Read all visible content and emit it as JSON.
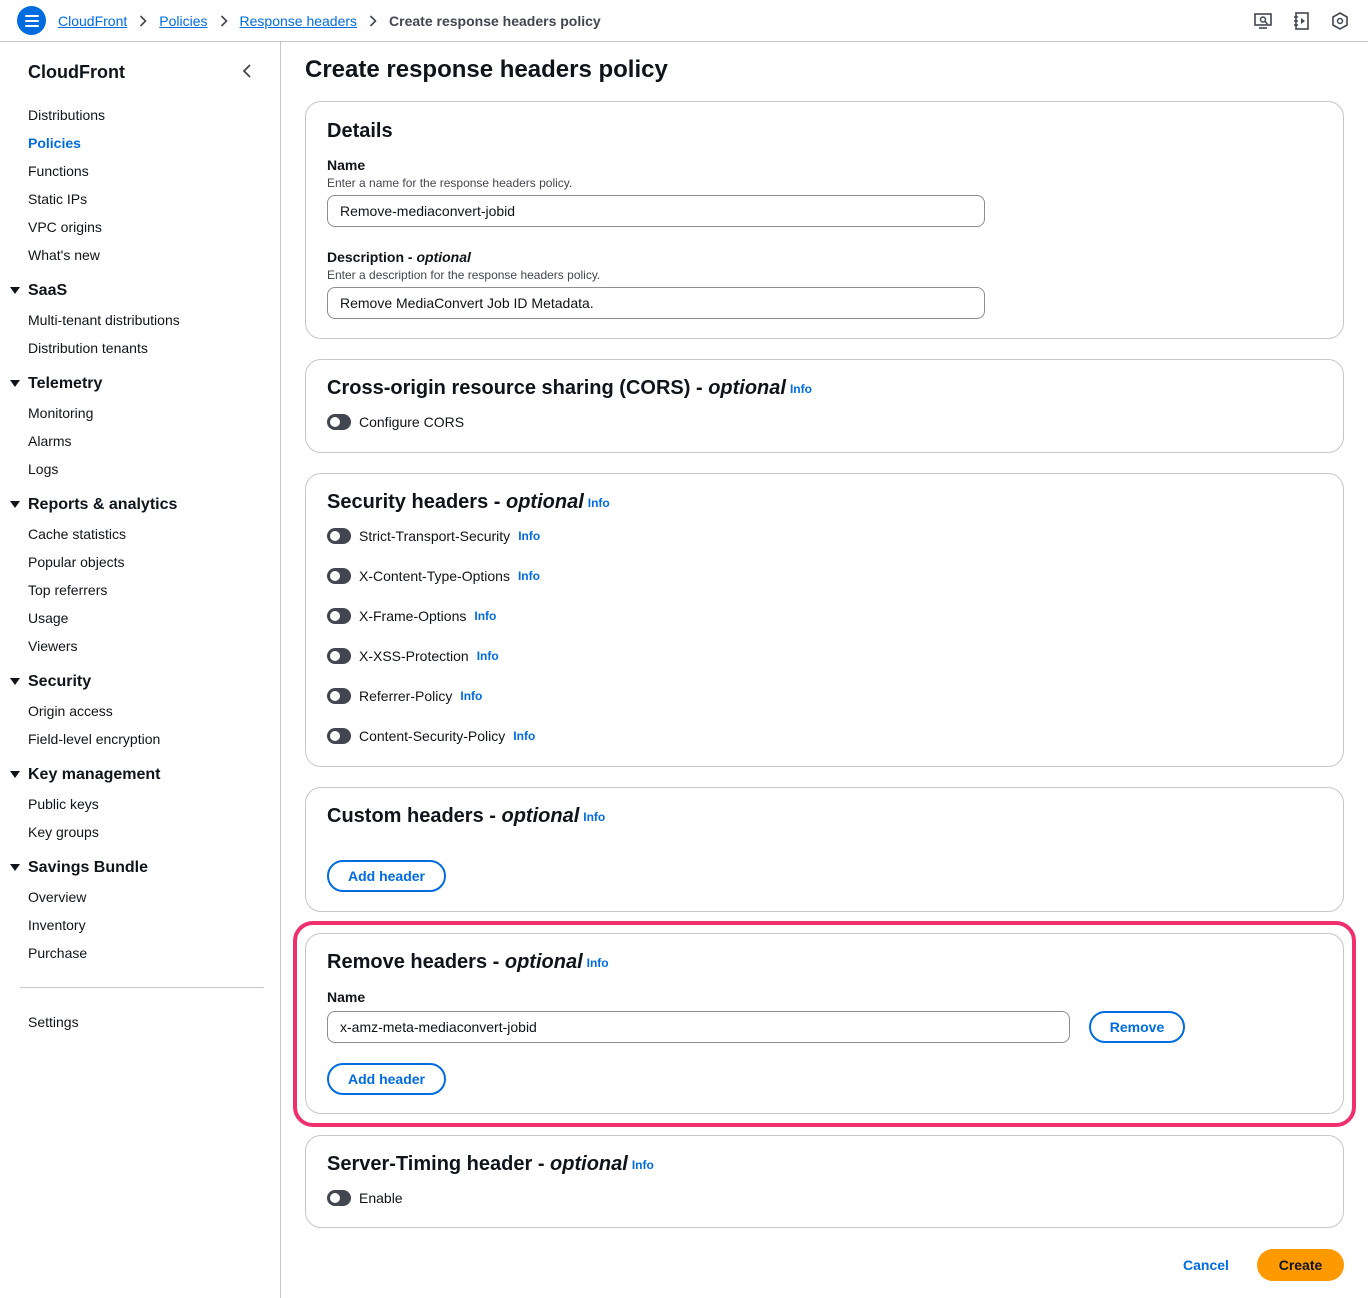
{
  "breadcrumb": {
    "items": [
      "CloudFront",
      "Policies",
      "Response headers"
    ],
    "current": "Create response headers policy"
  },
  "sidebar": {
    "title": "CloudFront",
    "top_items": [
      "Distributions",
      "Policies",
      "Functions",
      "Static IPs",
      "VPC origins",
      "What's new"
    ],
    "active_item": "Policies",
    "sections": [
      {
        "title": "SaaS",
        "items": [
          "Multi-tenant distributions",
          "Distribution tenants"
        ]
      },
      {
        "title": "Telemetry",
        "items": [
          "Monitoring",
          "Alarms",
          "Logs"
        ]
      },
      {
        "title": "Reports & analytics",
        "items": [
          "Cache statistics",
          "Popular objects",
          "Top referrers",
          "Usage",
          "Viewers"
        ]
      },
      {
        "title": "Security",
        "items": [
          "Origin access",
          "Field-level encryption"
        ]
      },
      {
        "title": "Key management",
        "items": [
          "Public keys",
          "Key groups"
        ]
      },
      {
        "title": "Savings Bundle",
        "items": [
          "Overview",
          "Inventory",
          "Purchase"
        ]
      }
    ],
    "settings": "Settings"
  },
  "page": {
    "title": "Create response headers policy"
  },
  "common": {
    "optional": "optional",
    "info": "Info",
    "dash": " - "
  },
  "details": {
    "heading": "Details",
    "name_label": "Name",
    "name_desc": "Enter a name for the response headers policy.",
    "name_value": "Remove-mediaconvert-jobid",
    "description_label": "Description",
    "description_desc": "Enter a description for the response headers policy.",
    "description_value": "Remove MediaConvert Job ID Metadata."
  },
  "cors": {
    "heading": "Cross-origin resource sharing (CORS)",
    "toggle_label": "Configure CORS"
  },
  "security_headers": {
    "heading": "Security headers",
    "toggles": [
      "Strict-Transport-Security",
      "X-Content-Type-Options",
      "X-Frame-Options",
      "X-XSS-Protection",
      "Referrer-Policy",
      "Content-Security-Policy"
    ]
  },
  "custom_headers": {
    "heading": "Custom headers",
    "add_button": "Add header"
  },
  "remove_headers": {
    "heading": "Remove headers",
    "name_label": "Name",
    "name_value": "x-amz-meta-mediaconvert-jobid",
    "remove_button": "Remove",
    "add_button": "Add header"
  },
  "server_timing": {
    "heading": "Server-Timing header",
    "toggle_label": "Enable"
  },
  "footer": {
    "cancel": "Cancel",
    "create": "Create"
  },
  "colors": {
    "accent": "#006ce0",
    "primary_button": "#ff9900",
    "highlight": "#f0306d"
  }
}
